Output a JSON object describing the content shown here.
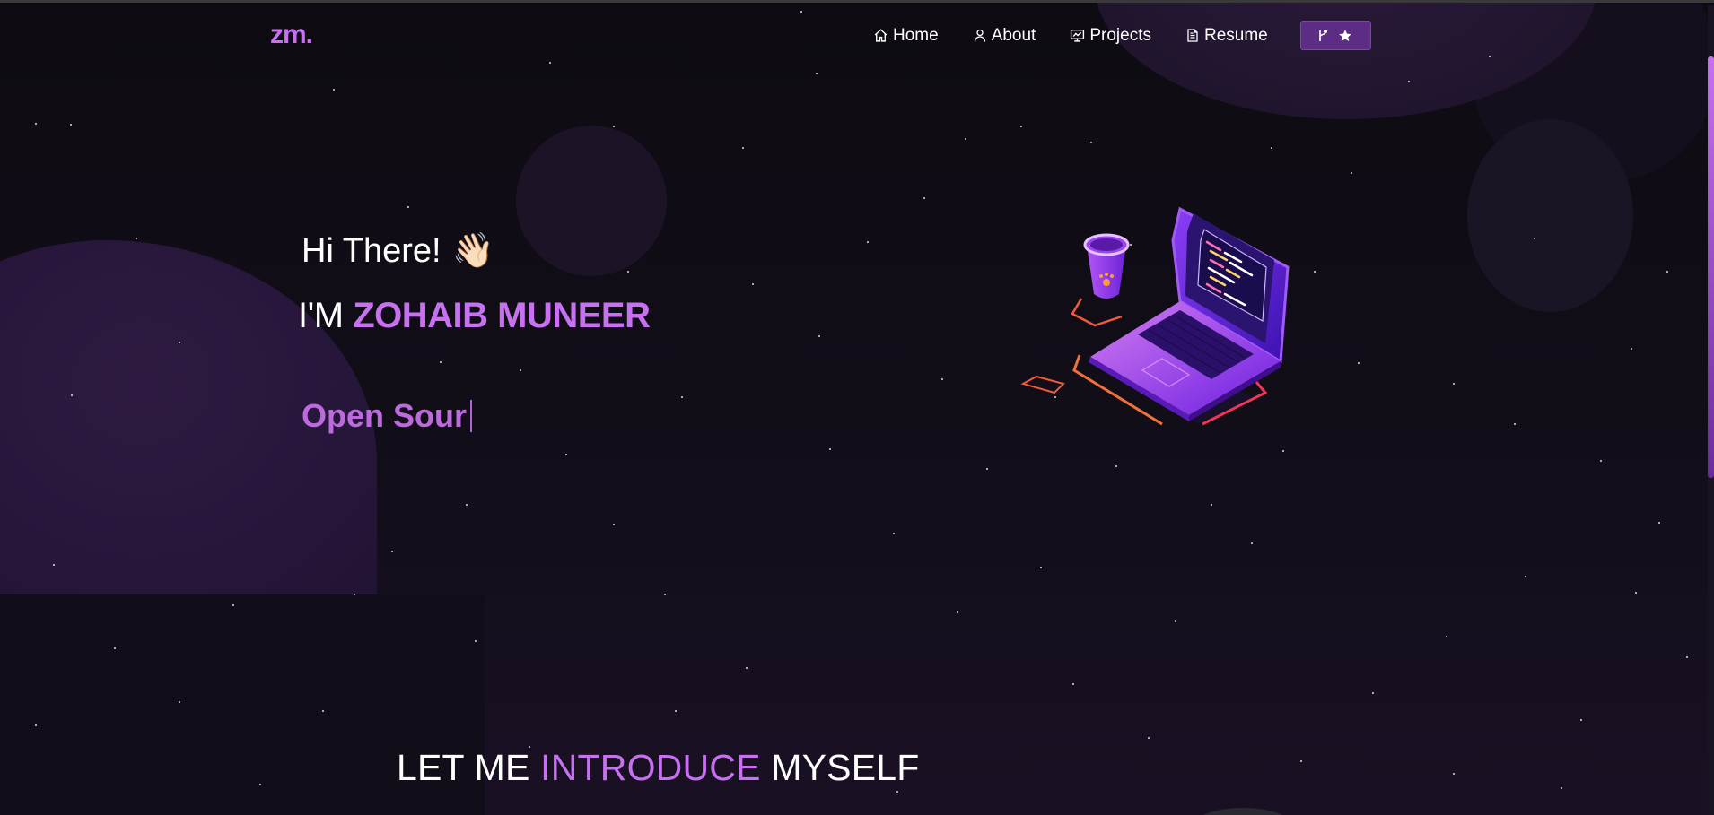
{
  "logo": {
    "text": "zm."
  },
  "nav": {
    "items": [
      {
        "label": "Home",
        "icon": "home-icon"
      },
      {
        "label": "About",
        "icon": "user-icon"
      },
      {
        "label": "Projects",
        "icon": "projects-icon"
      },
      {
        "label": "Resume",
        "icon": "document-icon"
      }
    ],
    "fork_button": {
      "icons": [
        "git-branch-icon",
        "star-icon"
      ]
    }
  },
  "hero": {
    "greeting": "Hi There!",
    "greeting_emoji": "👋🏻",
    "im_prefix": "I'M",
    "name": "ZOHAIB MUNEER",
    "typed_text": "Open Sour"
  },
  "intro": {
    "prefix": "LET ME",
    "accent": "INTRODUCE",
    "suffix": "MYSELF"
  },
  "colors": {
    "accent": "#c770f0",
    "background": "#0f0c13",
    "button": "#5d2c85"
  }
}
